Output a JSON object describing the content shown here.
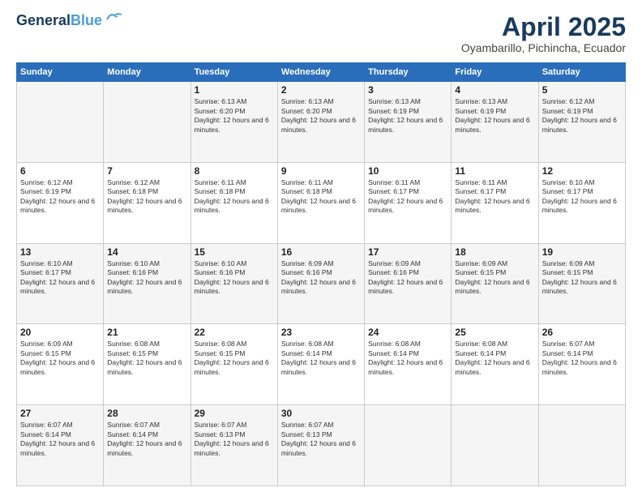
{
  "header": {
    "logo_line1": "General",
    "logo_line2": "Blue",
    "month_title": "April 2025",
    "location": "Oyambarillo, Pichincha, Ecuador"
  },
  "days_of_week": [
    "Sunday",
    "Monday",
    "Tuesday",
    "Wednesday",
    "Thursday",
    "Friday",
    "Saturday"
  ],
  "weeks": [
    [
      {
        "day": "",
        "content": ""
      },
      {
        "day": "",
        "content": ""
      },
      {
        "day": "1",
        "content": "Sunrise: 6:13 AM\nSunset: 6:20 PM\nDaylight: 12 hours and 6 minutes."
      },
      {
        "day": "2",
        "content": "Sunrise: 6:13 AM\nSunset: 6:20 PM\nDaylight: 12 hours and 6 minutes."
      },
      {
        "day": "3",
        "content": "Sunrise: 6:13 AM\nSunset: 6:19 PM\nDaylight: 12 hours and 6 minutes."
      },
      {
        "day": "4",
        "content": "Sunrise: 6:13 AM\nSunset: 6:19 PM\nDaylight: 12 hours and 6 minutes."
      },
      {
        "day": "5",
        "content": "Sunrise: 6:12 AM\nSunset: 6:19 PM\nDaylight: 12 hours and 6 minutes."
      }
    ],
    [
      {
        "day": "6",
        "content": "Sunrise: 6:12 AM\nSunset: 6:19 PM\nDaylight: 12 hours and 6 minutes."
      },
      {
        "day": "7",
        "content": "Sunrise: 6:12 AM\nSunset: 6:18 PM\nDaylight: 12 hours and 6 minutes."
      },
      {
        "day": "8",
        "content": "Sunrise: 6:11 AM\nSunset: 6:18 PM\nDaylight: 12 hours and 6 minutes."
      },
      {
        "day": "9",
        "content": "Sunrise: 6:11 AM\nSunset: 6:18 PM\nDaylight: 12 hours and 6 minutes."
      },
      {
        "day": "10",
        "content": "Sunrise: 6:11 AM\nSunset: 6:17 PM\nDaylight: 12 hours and 6 minutes."
      },
      {
        "day": "11",
        "content": "Sunrise: 6:11 AM\nSunset: 6:17 PM\nDaylight: 12 hours and 6 minutes."
      },
      {
        "day": "12",
        "content": "Sunrise: 6:10 AM\nSunset: 6:17 PM\nDaylight: 12 hours and 6 minutes."
      }
    ],
    [
      {
        "day": "13",
        "content": "Sunrise: 6:10 AM\nSunset: 6:17 PM\nDaylight: 12 hours and 6 minutes."
      },
      {
        "day": "14",
        "content": "Sunrise: 6:10 AM\nSunset: 6:16 PM\nDaylight: 12 hours and 6 minutes."
      },
      {
        "day": "15",
        "content": "Sunrise: 6:10 AM\nSunset: 6:16 PM\nDaylight: 12 hours and 6 minutes."
      },
      {
        "day": "16",
        "content": "Sunrise: 6:09 AM\nSunset: 6:16 PM\nDaylight: 12 hours and 6 minutes."
      },
      {
        "day": "17",
        "content": "Sunrise: 6:09 AM\nSunset: 6:16 PM\nDaylight: 12 hours and 6 minutes."
      },
      {
        "day": "18",
        "content": "Sunrise: 6:09 AM\nSunset: 6:15 PM\nDaylight: 12 hours and 6 minutes."
      },
      {
        "day": "19",
        "content": "Sunrise: 6:09 AM\nSunset: 6:15 PM\nDaylight: 12 hours and 6 minutes."
      }
    ],
    [
      {
        "day": "20",
        "content": "Sunrise: 6:09 AM\nSunset: 6:15 PM\nDaylight: 12 hours and 6 minutes."
      },
      {
        "day": "21",
        "content": "Sunrise: 6:08 AM\nSunset: 6:15 PM\nDaylight: 12 hours and 6 minutes."
      },
      {
        "day": "22",
        "content": "Sunrise: 6:08 AM\nSunset: 6:15 PM\nDaylight: 12 hours and 6 minutes."
      },
      {
        "day": "23",
        "content": "Sunrise: 6:08 AM\nSunset: 6:14 PM\nDaylight: 12 hours and 6 minutes."
      },
      {
        "day": "24",
        "content": "Sunrise: 6:08 AM\nSunset: 6:14 PM\nDaylight: 12 hours and 6 minutes."
      },
      {
        "day": "25",
        "content": "Sunrise: 6:08 AM\nSunset: 6:14 PM\nDaylight: 12 hours and 6 minutes."
      },
      {
        "day": "26",
        "content": "Sunrise: 6:07 AM\nSunset: 6:14 PM\nDaylight: 12 hours and 6 minutes."
      }
    ],
    [
      {
        "day": "27",
        "content": "Sunrise: 6:07 AM\nSunset: 6:14 PM\nDaylight: 12 hours and 6 minutes."
      },
      {
        "day": "28",
        "content": "Sunrise: 6:07 AM\nSunset: 6:14 PM\nDaylight: 12 hours and 6 minutes."
      },
      {
        "day": "29",
        "content": "Sunrise: 6:07 AM\nSunset: 6:13 PM\nDaylight: 12 hours and 6 minutes."
      },
      {
        "day": "30",
        "content": "Sunrise: 6:07 AM\nSunset: 6:13 PM\nDaylight: 12 hours and 6 minutes."
      },
      {
        "day": "",
        "content": ""
      },
      {
        "day": "",
        "content": ""
      },
      {
        "day": "",
        "content": ""
      }
    ]
  ]
}
